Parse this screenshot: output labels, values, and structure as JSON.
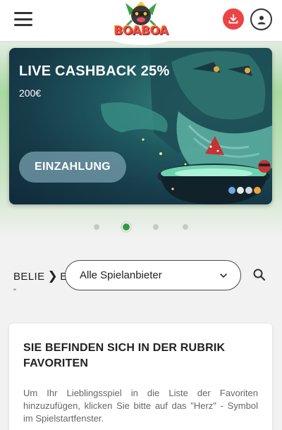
{
  "header": {
    "logo_text": "BOABOA",
    "menu_icon": "hamburger-icon",
    "download_icon": "download-icon",
    "user_icon": "user-icon",
    "accent": "#ec4444"
  },
  "banner": {
    "title": "LIVE CASHBACK 25%",
    "subtitle": "200€",
    "button_label": "EINZAHLUNG",
    "payment_icons": [
      "litecoin-icon",
      "ethereum-icon",
      "ripple-icon",
      "bitcoin-icon"
    ]
  },
  "carousel": {
    "slide_count": 4,
    "active_index": 1,
    "active_color": "#2f9b3c"
  },
  "filter": {
    "breadcrumb_start": "BELIE",
    "breadcrumb_end": "E",
    "breadcrumb_tail": "\"",
    "provider_select": {
      "selected": "Alle Spielanbieter"
    },
    "search_icon": "search-icon"
  },
  "info": {
    "title": "SIE BEFINDEN SICH IN DER RUBRIK FAVORITEN",
    "text": "Um Ihr Lieblingsspiel in die Liste der Favoriten hinzuzufügen, klicken Sie bitte auf das \"Herz\" - Symbol im Spielstartfenster."
  }
}
